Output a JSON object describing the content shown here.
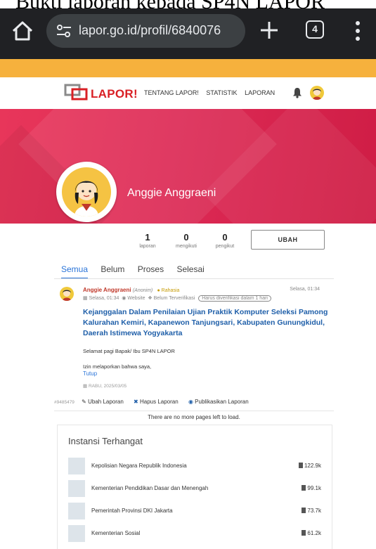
{
  "caption": "Bukti laporan kepada SP4N LAPOR",
  "browser": {
    "url": "lapor.go.id/profil/6840076",
    "tab_count": "4"
  },
  "site_nav": {
    "logo": "LAPOR!",
    "links": [
      "TENTANG LAPOR!",
      "STATISTIK",
      "LAPORAN"
    ]
  },
  "profile": {
    "name": "Anggie Anggraeni",
    "stats": [
      {
        "value": "1",
        "label": "laporan"
      },
      {
        "value": "0",
        "label": "mengikuti"
      },
      {
        "value": "0",
        "label": "pengikut"
      }
    ],
    "edit_label": "UBAH"
  },
  "tabs": [
    "Semua",
    "Belum",
    "Proses",
    "Selesai"
  ],
  "report": {
    "author": "Anggie Anggraeni",
    "anon": "(Anonim)",
    "privacy": "Rahasia",
    "time": "Selasa, 01:34",
    "date": "Selasa, 01:34",
    "channel": "Website",
    "status": "Belum Terverifikasi",
    "deadline": "Harus diverifikasi dalam 1 hari",
    "title": "Kejanggalan Dalam Penilaian Ujian Praktik Komputer Seleksi Pamong Kalurahan Kemiri, Kapanewon Tanjungsari, Kabupaten Gunungkidul, Daerah Istimewa Yogyakarta",
    "body_1": "Selamat pagi Bapak/ Ibu SP4N LAPOR",
    "body_2": "Izin melaporkan bahwa saya,",
    "close": "Tutup",
    "event_date": "RABU, 2025/03/05",
    "id": "#9485479",
    "actions": [
      "Ubah Laporan",
      "Hapus Laporan",
      "Publikasikan Laporan"
    ]
  },
  "no_more": "There are no more pages left to load.",
  "instansi": {
    "title": "Instansi Terhangat",
    "items": [
      {
        "name": "Kepolisian Negara Republik Indonesia",
        "count": "122.9k"
      },
      {
        "name": "Kementerian Pendidikan Dasar dan Menengah",
        "count": "99.1k"
      },
      {
        "name": "Pemerintah Provinsi DKI Jakarta",
        "count": "73.7k"
      },
      {
        "name": "Kementerian Sosial",
        "count": "61.2k"
      }
    ]
  },
  "colors": {
    "accent_red": "#d92025",
    "link_blue": "#1f5fa9",
    "band_orange": "#f6b13d"
  }
}
